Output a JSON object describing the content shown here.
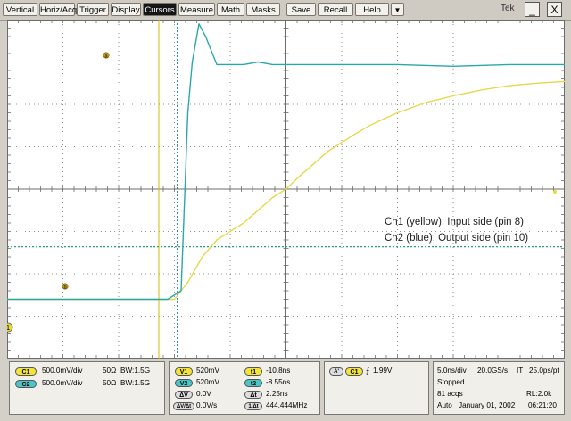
{
  "menu": {
    "items": [
      "Vertical",
      "Horiz/Acq",
      "Trigger",
      "Display",
      "Cursors",
      "Measure",
      "Math",
      "Masks",
      "Save",
      "Recall",
      "Help"
    ],
    "active": "Cursors",
    "dropdown_glyph": "▼",
    "logo": "Tek",
    "min_glyph": "_",
    "close_glyph": "X"
  },
  "colors": {
    "ch1": "#e6d84a",
    "ch2": "#2aa8a8",
    "grid": "#6c6c6c",
    "cursor_v1": "#d8b800",
    "cursor_v2": "#1a7f9f",
    "cursor_h": "#2aa06a"
  },
  "annotations": [
    "Ch1 (yellow): Input side (pin 8)",
    "Ch2 (blue): Output side (pin 10)"
  ],
  "markers": {
    "cursor_a": "a",
    "cursor_b": "b",
    "ch1_ground": "1"
  },
  "channels": [
    {
      "id": "C1",
      "scale": "500.0mV/div",
      "imp": "50Ω",
      "bw": "BW:1.5G"
    },
    {
      "id": "C2",
      "scale": "500.0mV/div",
      "imp": "50Ω",
      "bw": "BW:1.5G"
    }
  ],
  "cursors": {
    "v1_label": "V1",
    "v1": "520mV",
    "v2_label": "V2",
    "v2": "520mV",
    "dv_label": "ΔV",
    "dv": "0.0V",
    "dvdt_label": "ΔV/Δt",
    "dvdt": "0.0V/s",
    "t1_label": "t1",
    "t1": "-10.8ns",
    "t2_label": "t2",
    "t2": "-8.55ns",
    "dt_label": "Δt",
    "dt": "2.25ns",
    "inv_label": "1/Δt",
    "inv": "444.444MHz"
  },
  "trigger": {
    "mode": "A'",
    "src": "C1",
    "slope": "⨍",
    "level": "1.99V"
  },
  "acq": {
    "timebase": "5.0ns/div",
    "rate": "20.0GS/s",
    "mode": "IT",
    "res": "25.0ps/pt",
    "state": "Stopped",
    "acqs": "81 acqs",
    "rl": "RL:2.0k",
    "auto": "Auto",
    "date": "January 01, 2002",
    "time": "06:21:20"
  },
  "chart_data": {
    "type": "line",
    "xlabel": "",
    "ylabel": "",
    "x_unit": "ns",
    "x_per_div": 5,
    "xlim": [
      -50,
      0
    ],
    "ylim": [
      -2,
      2
    ],
    "x_divs": 10,
    "y_divs": 8,
    "grid": true,
    "series": [
      {
        "x": [
          -50,
          -40,
          -35,
          -33.8,
          -32.5,
          -31.2,
          -30,
          -28.8,
          -27.5,
          -26.2,
          -25,
          -23.8,
          -22.5,
          -21.2,
          -20,
          -18.8,
          -17.5,
          -16.2,
          -15,
          -12.5,
          -10,
          -7.5,
          -5,
          -2.5,
          0
        ],
        "values": [
          -1.3,
          -1.3,
          -1.3,
          -1.1,
          -0.8,
          -0.6,
          -0.5,
          -0.4,
          -0.25,
          -0.1,
          0,
          0.15,
          0.3,
          0.45,
          0.55,
          0.65,
          0.75,
          0.83,
          0.9,
          1.02,
          1.1,
          1.17,
          1.22,
          1.25,
          1.27
        ]
      },
      {
        "x": [
          -50,
          -40,
          -35.6,
          -34.4,
          -33.8,
          -33.4,
          -32.8,
          -32.2,
          -31.2,
          -30,
          -28.8,
          -27.5,
          -26.2,
          -25,
          -22.5,
          -20,
          -15,
          -10,
          -5,
          0
        ],
        "values": [
          -1.3,
          -1.3,
          -1.3,
          -1.2,
          0.9,
          1.5,
          1.95,
          1.8,
          1.47,
          1.47,
          1.47,
          1.5,
          1.47,
          1.47,
          1.47,
          1.47,
          1.47,
          1.45,
          1.47,
          1.47
        ]
      }
    ]
  }
}
